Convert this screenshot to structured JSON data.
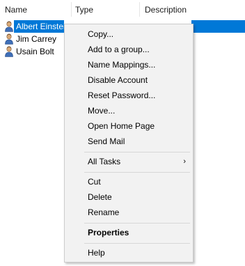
{
  "columns": {
    "name": "Name",
    "type": "Type",
    "description": "Description"
  },
  "rows": [
    {
      "name": "Albert Einstein",
      "selected": true,
      "icon": "user-icon"
    },
    {
      "name": "Jim Carrey",
      "selected": false,
      "icon": "user-icon"
    },
    {
      "name": "Usain Bolt",
      "selected": false,
      "icon": "user-icon"
    }
  ],
  "context_menu": {
    "items": [
      {
        "label": "Copy..."
      },
      {
        "label": "Add to a group..."
      },
      {
        "label": "Name Mappings..."
      },
      {
        "label": "Disable Account"
      },
      {
        "label": "Reset Password..."
      },
      {
        "label": "Move..."
      },
      {
        "label": "Open Home Page"
      },
      {
        "label": "Send Mail"
      },
      {
        "label": "All Tasks",
        "submenu": true,
        "arrow": "›"
      },
      {
        "label": "Cut"
      },
      {
        "label": "Delete"
      },
      {
        "label": "Rename"
      },
      {
        "label": "Properties",
        "bold": true
      },
      {
        "label": "Help"
      }
    ]
  },
  "colors": {
    "selection": "#0078d7",
    "menu_bg": "#f2f2f2"
  }
}
